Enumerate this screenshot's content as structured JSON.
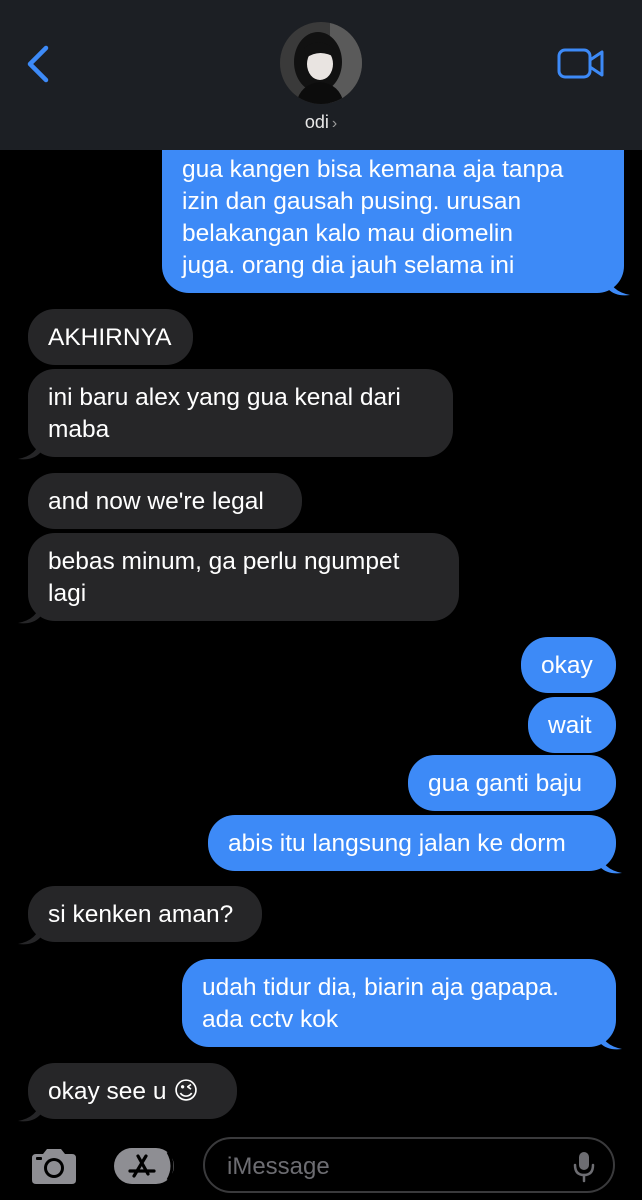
{
  "header": {
    "contact_name": "odi",
    "chevron": "›",
    "back_icon": "chevron-left-icon",
    "video_icon": "video-camera-icon",
    "accent_color": "#3d8af7"
  },
  "messages": [
    {
      "id": "m1",
      "dir": "out",
      "text": "gua kangen bisa kemana aja tanpa\nizin dan gausah pusing. urusan\nbelakangan kalo mau diomelin\njuga. orang dia jauh selama ini"
    },
    {
      "id": "m2",
      "dir": "in",
      "text": "AKHIRNYA"
    },
    {
      "id": "m3",
      "dir": "in",
      "text": "ini baru alex yang gua kenal dari\nmaba"
    },
    {
      "id": "m4",
      "dir": "in",
      "text": "and now we're legal"
    },
    {
      "id": "m5",
      "dir": "in",
      "text": "bebas minum, ga perlu ngumpet\nlagi"
    },
    {
      "id": "m6",
      "dir": "out",
      "text": "okay"
    },
    {
      "id": "m7",
      "dir": "out",
      "text": "wait"
    },
    {
      "id": "m8",
      "dir": "out",
      "text": "gua ganti baju"
    },
    {
      "id": "m9",
      "dir": "out",
      "text": "abis itu langsung jalan ke dorm"
    },
    {
      "id": "m10",
      "dir": "in",
      "text": "si kenken aman?"
    },
    {
      "id": "m11",
      "dir": "out",
      "text": "udah tidur dia, biarin aja gapapa.\nada cctv kok"
    },
    {
      "id": "m12",
      "dir": "in",
      "text": "okay see u 😉"
    }
  ],
  "composer": {
    "placeholder": "iMessage",
    "camera_icon": "camera-icon",
    "appstore_icon": "app-store-icon",
    "mic_icon": "microphone-icon"
  },
  "colors": {
    "incoming_bubble": "#262628",
    "outgoing_bubble": "#3d8af7",
    "background": "#000000"
  }
}
